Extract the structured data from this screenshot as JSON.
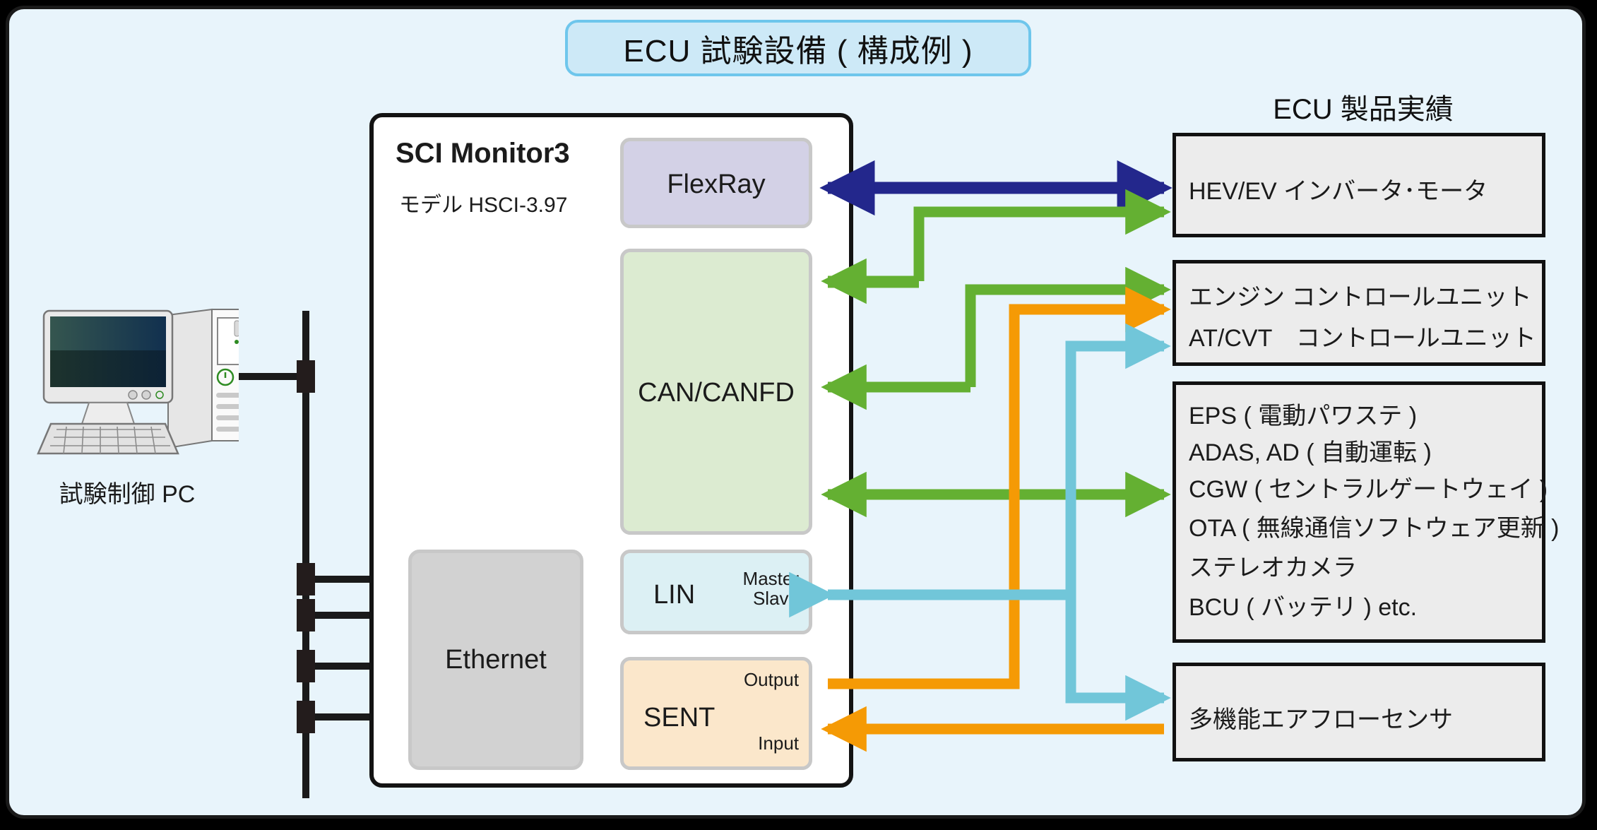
{
  "title": {
    "text": "ECU 試験設備 ( 構成例 )"
  },
  "right_panel": {
    "heading": "ECU 製品実績"
  },
  "device": {
    "name": "SCI Monitor3",
    "model": "モデル HSCI-3.97"
  },
  "protocol_blocks": [
    {
      "id": "flexray",
      "label": "FlexRay",
      "color": "#D3D1E6"
    },
    {
      "id": "can",
      "label": "CAN/CANFD",
      "color": "#DCEBD1"
    },
    {
      "id": "lin",
      "label": "LIN",
      "sub": "Master\nSlave",
      "sub_line1": "Master",
      "sub_line2": "Slave",
      "color": "#DCF0F4"
    },
    {
      "id": "sent",
      "label": "SENT",
      "output_label": "Output",
      "input_label": "Input",
      "color": "#FBE7CB"
    },
    {
      "id": "ethernet",
      "label": "Ethernet",
      "color": "#D2D2D2"
    }
  ],
  "ecu_boxes": [
    {
      "id": "ecu1",
      "lines": [
        "HEV/EV インバータ･モータ"
      ]
    },
    {
      "id": "ecu2",
      "lines": [
        "エンジン コントロールユニット",
        "AT/CVT　コントロールユニット"
      ]
    },
    {
      "id": "ecu3",
      "lines": [
        "EPS ( 電動パワステ )",
        "ADAS, AD ( 自動運転 )",
        "CGW ( セントラルゲートウェイ )",
        "OTA ( 無線通信ソフトウェア更新 )",
        "ステレオカメラ",
        "BCU ( バッテリ ) etc."
      ]
    },
    {
      "id": "ecu4",
      "lines": [
        "多機能エアフローセンサ"
      ]
    }
  ],
  "pc": {
    "label": "試験制御 PC",
    "icon": "desktop-computer-icon"
  },
  "arrow_colors": {
    "flexray": "#23278C",
    "can": "#64B032",
    "sent": "#F59A05",
    "lin": "#71C6D9"
  }
}
